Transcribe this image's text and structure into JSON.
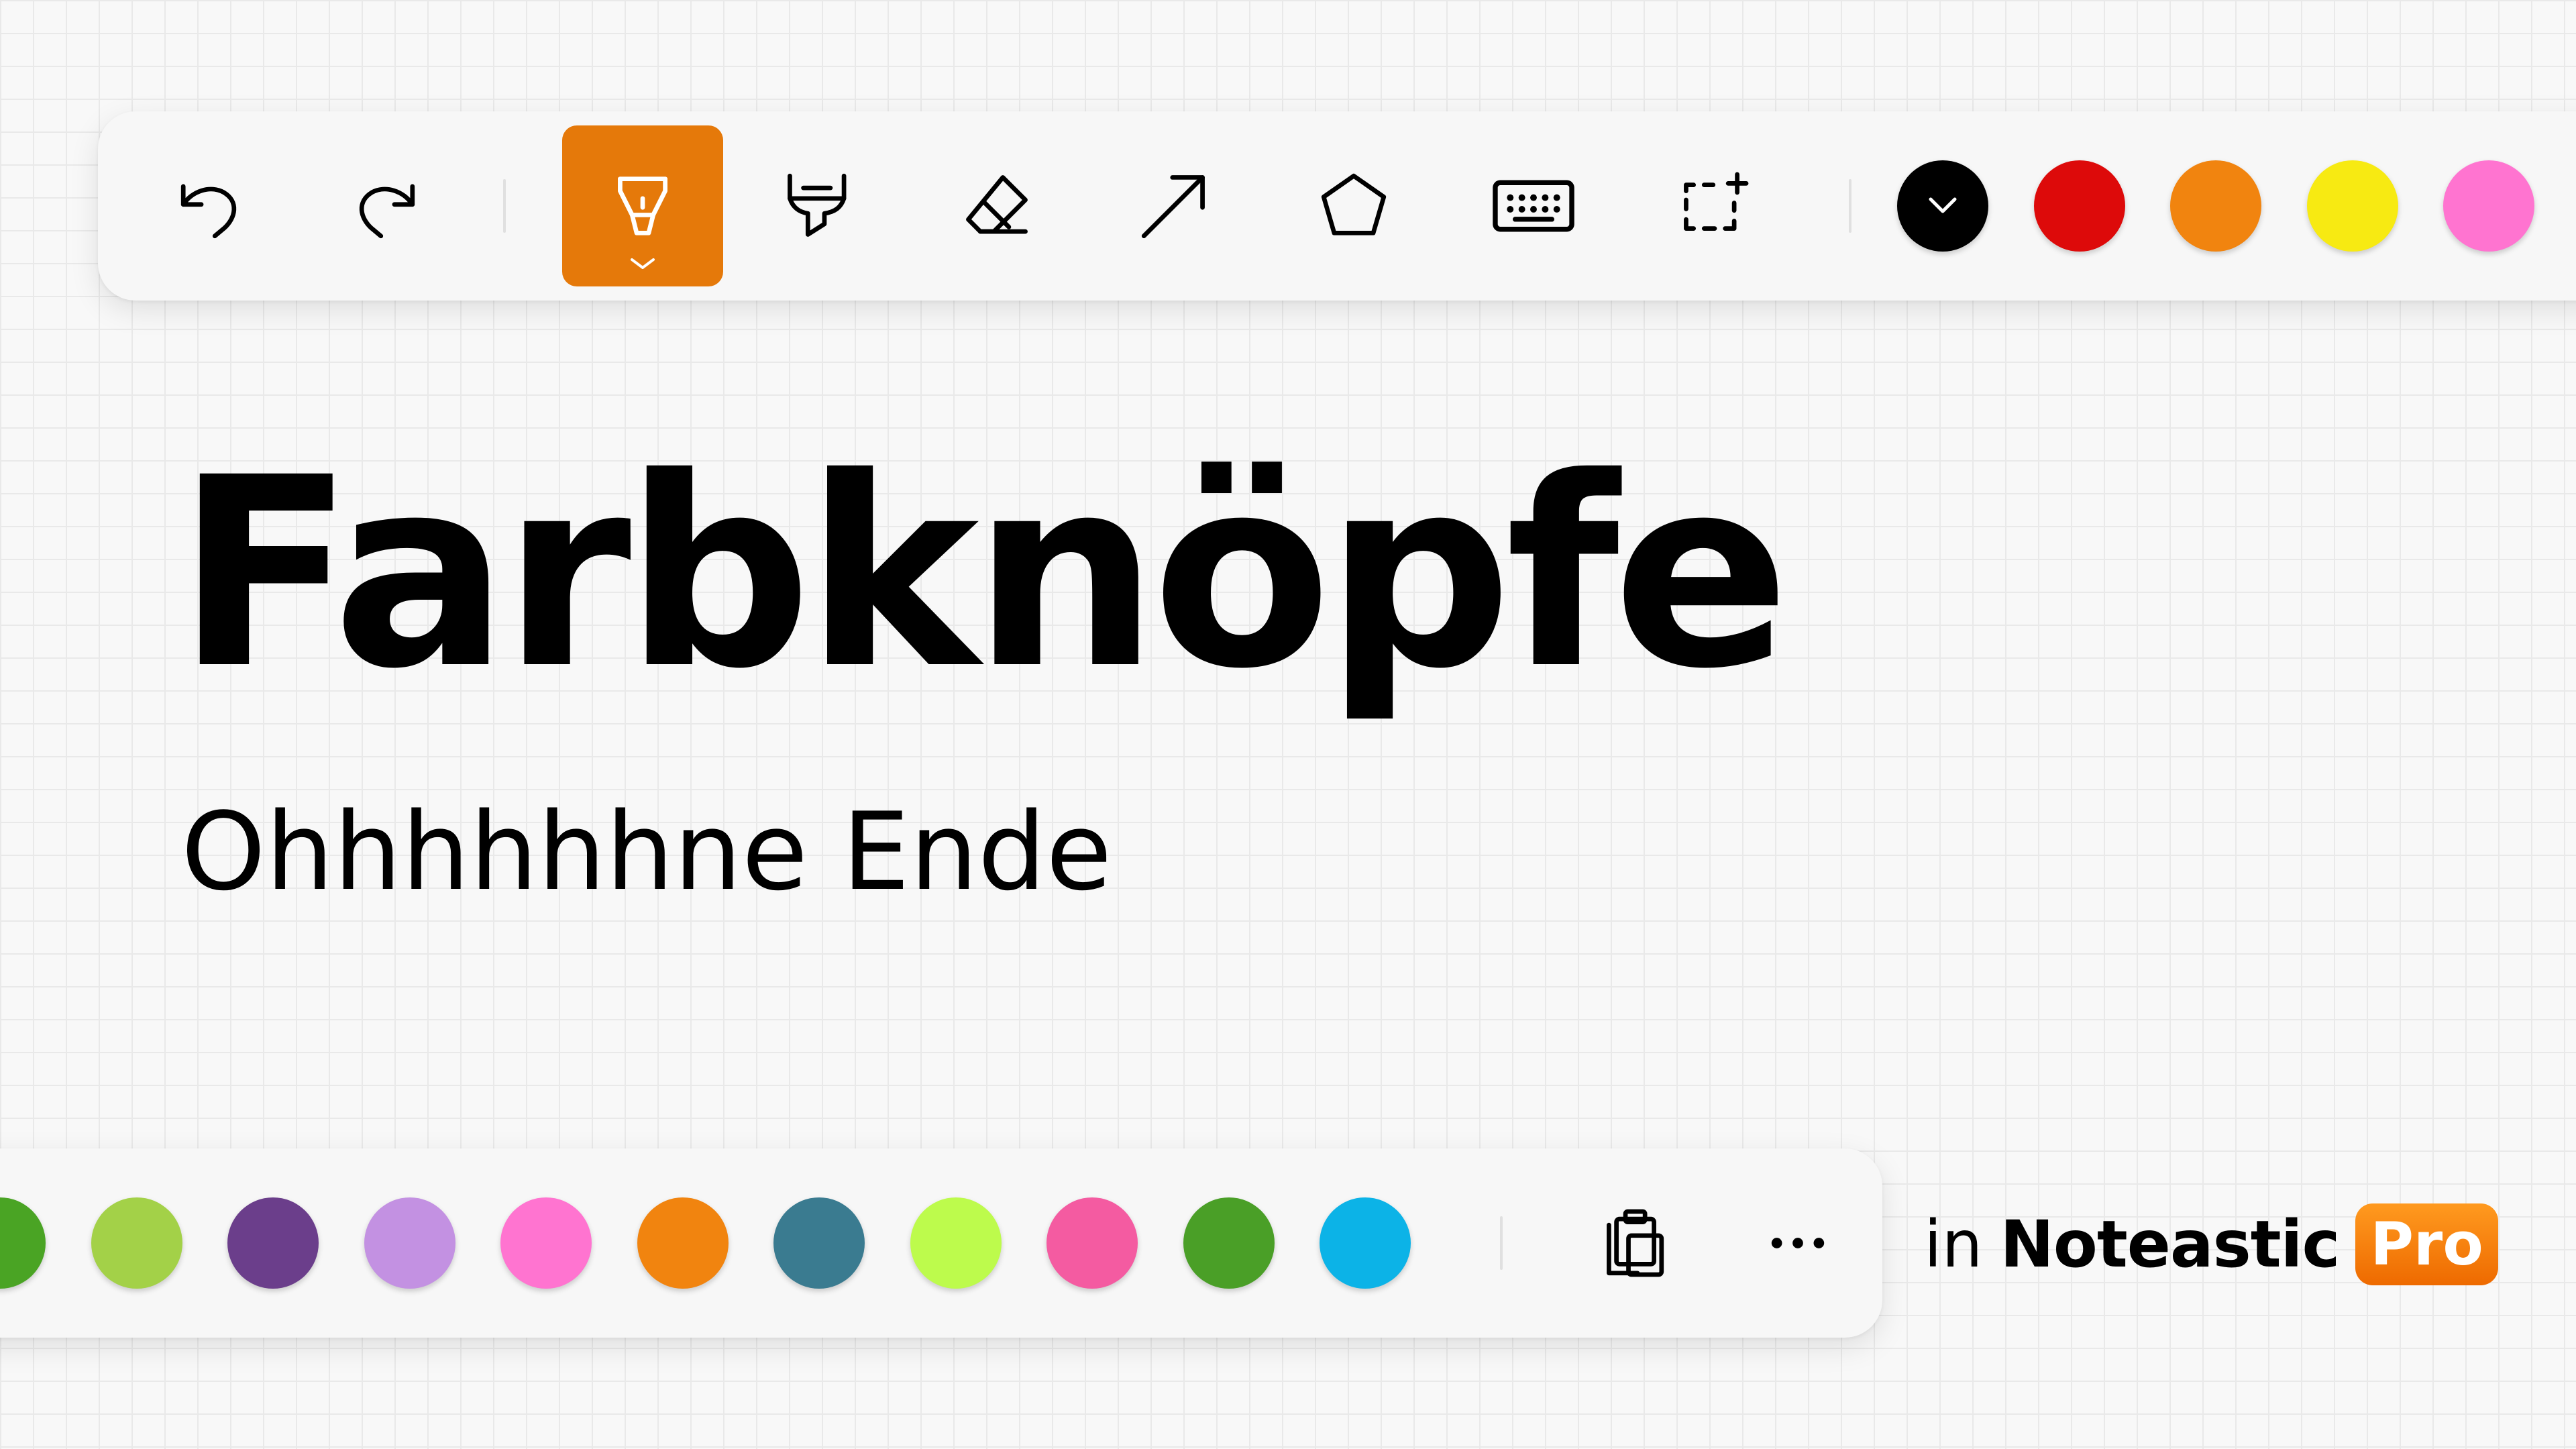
{
  "top_toolbar": {
    "tools": [
      {
        "id": "undo",
        "icon": "undo-icon"
      },
      {
        "id": "redo",
        "icon": "redo-icon"
      },
      {
        "id": "pen",
        "icon": "fountain-pen-icon",
        "active": true,
        "has_dropdown": true
      },
      {
        "id": "highlighter",
        "icon": "highlighter-icon"
      },
      {
        "id": "eraser",
        "icon": "eraser-icon"
      },
      {
        "id": "arrow",
        "icon": "arrow-icon"
      },
      {
        "id": "shape",
        "icon": "pentagon-icon"
      },
      {
        "id": "keyboard",
        "icon": "keyboard-icon"
      },
      {
        "id": "lasso",
        "icon": "selection-add-icon"
      }
    ],
    "colors": [
      "#000000",
      "#dd0a0a",
      "#f1840f",
      "#f7ea12",
      "#ff74d0"
    ],
    "selected_color": "#000000",
    "accent": "#e5790a"
  },
  "headline": {
    "title": "Farbknöpfe",
    "subtitle": "Ohhhhhhne Ende"
  },
  "bottom_toolbar": {
    "colors": [
      "#4aa424",
      "#a3d148",
      "#6b3e8b",
      "#c391e2",
      "#ff74d0",
      "#f1840f",
      "#3a7b90",
      "#bdfb4c",
      "#f45ba1",
      "#4a9f27",
      "#0cb3e7"
    ],
    "actions": [
      {
        "id": "paste",
        "icon": "clipboard-icon"
      },
      {
        "id": "more",
        "icon": "more-icon"
      }
    ]
  },
  "brand": {
    "prefix": "in",
    "name": "Noteastic",
    "badge": "Pro"
  }
}
